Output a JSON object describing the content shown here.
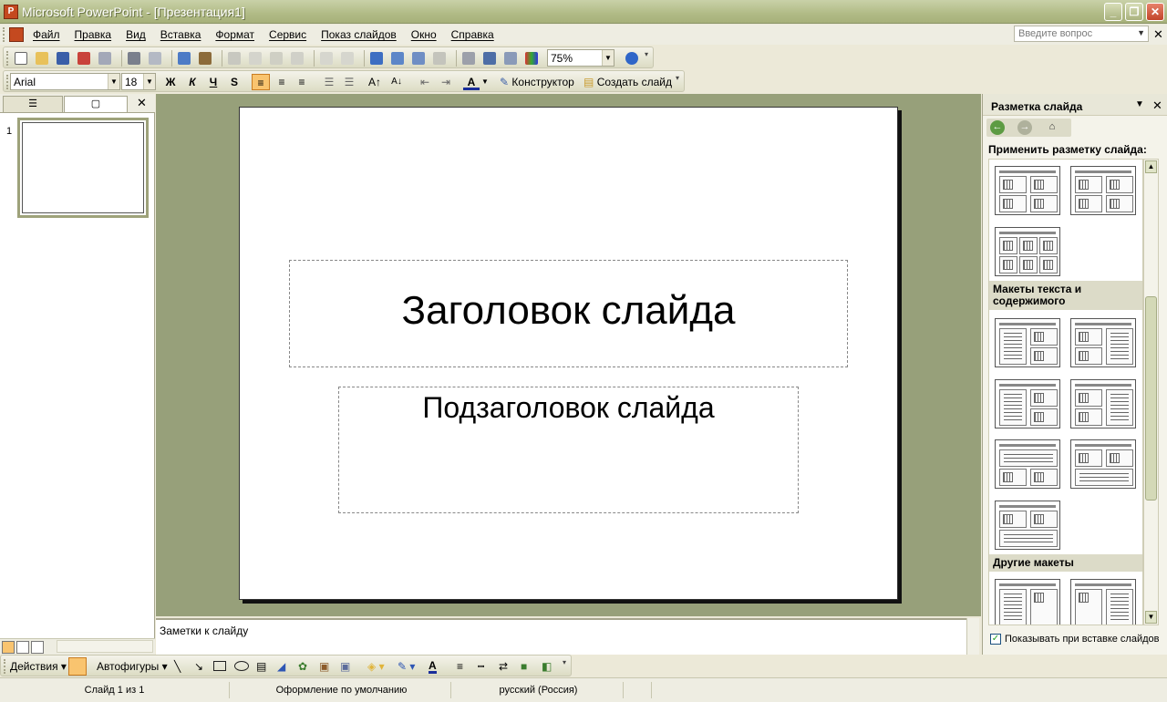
{
  "window": {
    "title": "Microsoft PowerPoint - [Презентация1]",
    "app_icon": "P"
  },
  "menu": {
    "items": [
      "Файл",
      "Правка",
      "Вид",
      "Вставка",
      "Формат",
      "Сервис",
      "Показ слайдов",
      "Окно",
      "Справка"
    ],
    "ask_placeholder": "Введите вопрос"
  },
  "standard_toolbar": {
    "zoom": "75%"
  },
  "formatting_toolbar": {
    "font": "Arial",
    "size": "18",
    "bold": "Ж",
    "italic": "К",
    "underline": "Ч",
    "shadow": "S",
    "designer_label": "Конструктор",
    "new_slide_label": "Создать слайд"
  },
  "slides_pane": {
    "slide_number": "1"
  },
  "slide": {
    "title": "Заголовок слайда",
    "subtitle": "Подзаголовок слайда"
  },
  "notes": {
    "placeholder": "Заметки к слайду"
  },
  "task_pane": {
    "title": "Разметка слайда",
    "apply_label": "Применить разметку слайда:",
    "section_text_content": "Макеты текста и содержимого",
    "section_other": "Другие макеты",
    "show_on_insert_label": "Показывать при вставке слайдов",
    "show_on_insert_checked": true
  },
  "drawing_toolbar": {
    "actions_label": "Действия",
    "autoshapes_label": "Автофигуры"
  },
  "status": {
    "slide_counter": "Слайд 1 из 1",
    "design": "Оформление по умолчанию",
    "language": "русский (Россия)"
  },
  "colors": {
    "slide_bg": "#97A07A",
    "title_bar": "#B1BB86",
    "accent_red": "#C4491F"
  }
}
